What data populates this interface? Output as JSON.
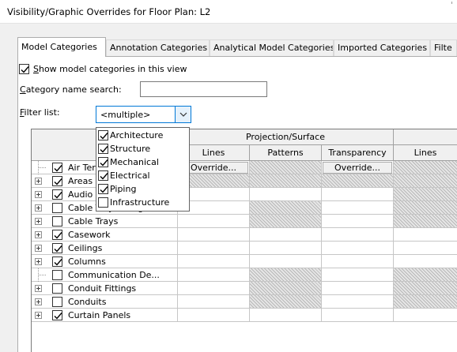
{
  "window": {
    "title": "Visibility/Graphic Overrides for Floor Plan: L2"
  },
  "tabs": [
    {
      "label": "Model Categories",
      "active": true
    },
    {
      "label": "Annotation Categories",
      "active": false
    },
    {
      "label": "Analytical Model Categories",
      "active": false
    },
    {
      "label": "Imported Categories",
      "active": false
    },
    {
      "label": "Filte",
      "active": false
    }
  ],
  "options": {
    "show_model_categories": {
      "label_accel": "S",
      "label_rest": "how model categories in this view",
      "checked": true
    },
    "category_search": {
      "label_accel": "C",
      "label_rest": "ategory name search:",
      "value": ""
    },
    "filter_list": {
      "label_accel": "F",
      "label_rest": "ilter list:",
      "value": "<multiple>"
    }
  },
  "filter_options": [
    {
      "label": "Architecture",
      "checked": true
    },
    {
      "label": "Structure",
      "checked": true
    },
    {
      "label": "Mechanical",
      "checked": true
    },
    {
      "label": "Electrical",
      "checked": true
    },
    {
      "label": "Piping",
      "checked": true
    },
    {
      "label": "Infrastructure",
      "checked": false
    }
  ],
  "grid": {
    "header_visibility": "Vi",
    "header_projection": "Projection/Surface",
    "columns": [
      "Lines",
      "Patterns",
      "Transparency",
      "Lines"
    ],
    "override_label": "Override...",
    "rows": [
      {
        "name": "Air Ter",
        "checked": true,
        "expandable": false,
        "hatch": [
          false,
          true,
          false,
          true
        ],
        "overrides": true
      },
      {
        "name": "Areas",
        "checked": true,
        "expandable": true,
        "hatch": [
          true,
          true,
          true,
          true
        ],
        "overrides": false
      },
      {
        "name": "Audio",
        "checked": true,
        "expandable": true,
        "hatch": [
          false,
          false,
          false,
          true
        ],
        "overrides": false
      },
      {
        "name": "Cable Tray Fittings",
        "checked": false,
        "expandable": true,
        "hatch": [
          false,
          true,
          false,
          true
        ],
        "overrides": false
      },
      {
        "name": "Cable Trays",
        "checked": false,
        "expandable": true,
        "hatch": [
          false,
          true,
          false,
          true
        ],
        "overrides": false
      },
      {
        "name": "Casework",
        "checked": true,
        "expandable": true,
        "hatch": [
          false,
          false,
          false,
          false
        ],
        "overrides": false
      },
      {
        "name": "Ceilings",
        "checked": true,
        "expandable": true,
        "hatch": [
          false,
          false,
          false,
          false
        ],
        "overrides": false
      },
      {
        "name": "Columns",
        "checked": true,
        "expandable": true,
        "hatch": [
          false,
          false,
          false,
          false
        ],
        "overrides": false
      },
      {
        "name": "Communication De...",
        "checked": false,
        "expandable": false,
        "hatch": [
          false,
          true,
          false,
          true
        ],
        "overrides": false
      },
      {
        "name": "Conduit Fittings",
        "checked": false,
        "expandable": true,
        "hatch": [
          false,
          true,
          false,
          true
        ],
        "overrides": false
      },
      {
        "name": "Conduits",
        "checked": false,
        "expandable": true,
        "hatch": [
          false,
          true,
          false,
          true
        ],
        "overrides": false
      },
      {
        "name": "Curtain Panels",
        "checked": true,
        "expandable": true,
        "hatch": [
          false,
          false,
          false,
          false
        ],
        "overrides": false
      }
    ]
  }
}
